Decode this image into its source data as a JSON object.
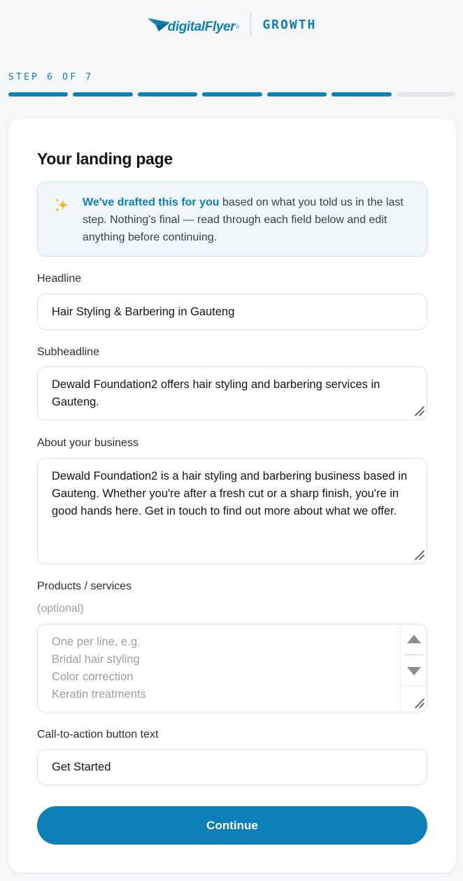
{
  "brand": {
    "logo_text": "digitalFlyer",
    "logo_reg": "®",
    "product": "GROWTH"
  },
  "progress": {
    "label": "STEP 6 OF 7",
    "current": 6,
    "total": 7
  },
  "card": {
    "title": "Your landing page",
    "notice": {
      "highlight": "We've drafted this for you",
      "text": " based on what you told us in the last step. Nothing's final — read through each field below and edit anything before continuing."
    },
    "fields": {
      "headline": {
        "label": "Headline",
        "value": "Hair Styling & Barbering in Gauteng"
      },
      "subheadline": {
        "label": "Subheadline",
        "value": "Dewald Foundation2 offers hair styling and barbering services in Gauteng."
      },
      "about": {
        "label": "About your business",
        "value": "Dewald Foundation2 is a hair styling and barbering business based in Gauteng. Whether you're after a fresh cut or a sharp finish, you're in good hands here. Get in touch to find out more about what we offer."
      },
      "products": {
        "label": "Products / services",
        "optional": "(optional)",
        "placeholder": "One per line, e.g.\nBridal hair styling\nColor correction\nKeratin treatments"
      },
      "cta": {
        "label": "Call-to-action button text",
        "value": "Get Started"
      }
    },
    "continue_label": "Continue"
  },
  "colors": {
    "accent": "#0f7fb8",
    "notice_bg": "#eff7fb",
    "page_bg": "#f6f7f9"
  },
  "icons": {
    "notice": "sparkles-icon"
  }
}
